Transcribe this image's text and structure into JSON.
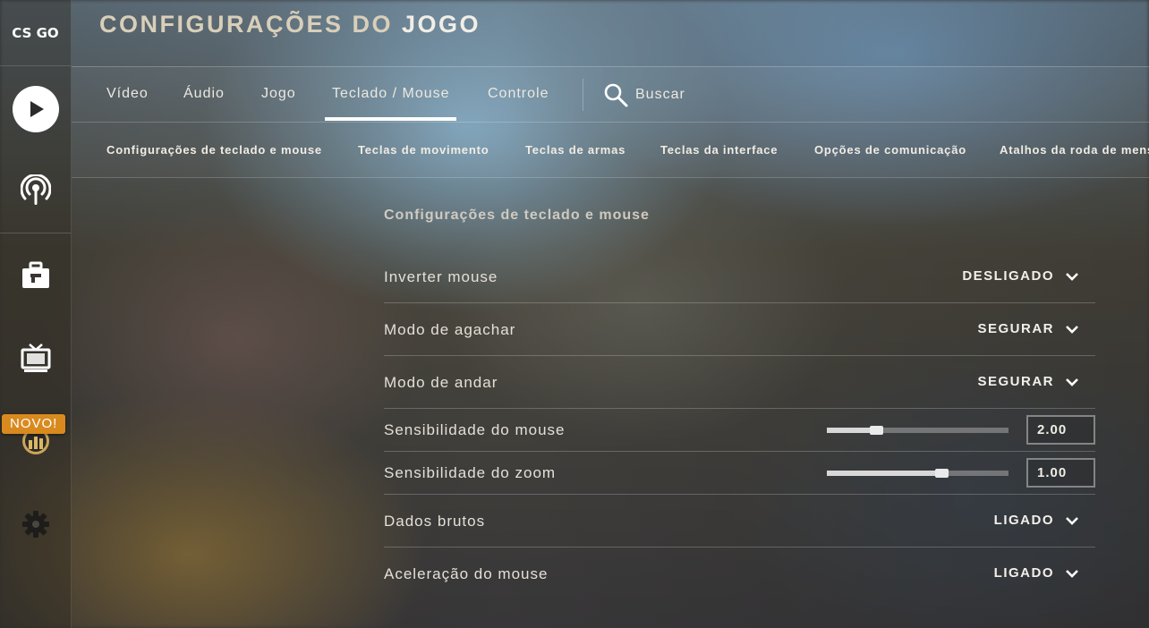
{
  "sidebar": {
    "logo": "CS GO",
    "badge": "NOVO!"
  },
  "header": {
    "title_prefix": "CONFIGURAÇÕES DO",
    "title_highlight": "JOGO"
  },
  "tabs": [
    {
      "label": "Vídeo",
      "active": false
    },
    {
      "label": "Áudio",
      "active": false
    },
    {
      "label": "Jogo",
      "active": false
    },
    {
      "label": "Teclado / Mouse",
      "active": true
    },
    {
      "label": "Controle",
      "active": false
    }
  ],
  "search": {
    "label": "Buscar"
  },
  "subtabs": [
    "Configurações de teclado e mouse",
    "Teclas de movimento",
    "Teclas de armas",
    "Teclas da interface",
    "Opções de comunicação",
    "Atalhos da roda de mensagens"
  ],
  "section": {
    "title": "Configurações de teclado e mouse",
    "settings": [
      {
        "label": "Inverter mouse",
        "type": "dropdown",
        "value": "DESLIGADO"
      },
      {
        "label": "Modo de agachar",
        "type": "dropdown",
        "value": "SEGURAR"
      },
      {
        "label": "Modo de andar",
        "type": "dropdown",
        "value": "SEGURAR"
      },
      {
        "label": "Sensibilidade do mouse",
        "type": "slider",
        "value": "2.00",
        "fraction": 0.27
      },
      {
        "label": "Sensibilidade do zoom",
        "type": "slider",
        "value": "1.00",
        "fraction": 0.63
      },
      {
        "label": "Dados brutos",
        "type": "dropdown",
        "value": "LIGADO"
      },
      {
        "label": "Aceleração do mouse",
        "type": "dropdown",
        "value": "LIGADO"
      }
    ]
  },
  "colors": {
    "badge": "#d98a1e",
    "title": "#d9cfb9",
    "title_highlight": "#f2eee6"
  }
}
